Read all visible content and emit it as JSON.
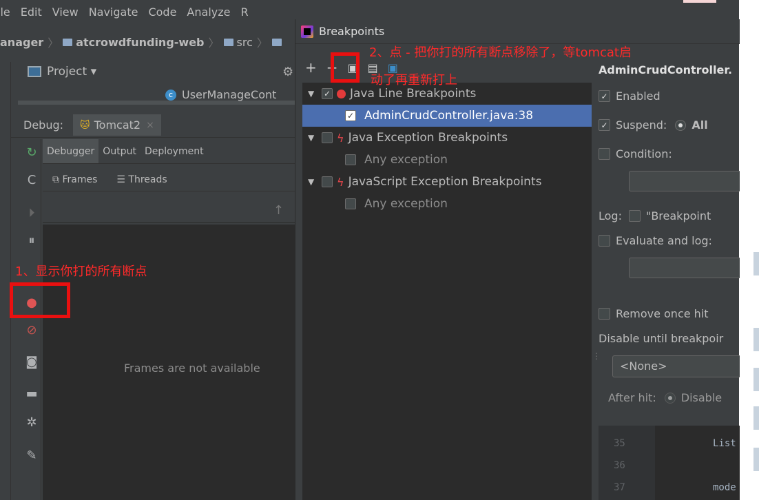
{
  "menubar": {
    "items": [
      "ile",
      "Edit",
      "View",
      "Navigate",
      "Code",
      "Analyze",
      "R"
    ]
  },
  "navbar": {
    "crumbs": [
      "anager",
      "atcrowdfunding-web",
      "src"
    ]
  },
  "project_panel": {
    "label": "Project ▾"
  },
  "editor_tab": {
    "label": "UserManageCont"
  },
  "debug": {
    "label": "Debug:",
    "config_tab": "Tomcat2",
    "subtabs": [
      "Debugger",
      "Output",
      "Deployment"
    ],
    "frames_tab": "Frames",
    "threads_tab": "Threads",
    "empty_message": "Frames are not available"
  },
  "annotations": {
    "step1": "1、显示你打的所有断点",
    "step2_line1": "2、点 - 把你打的所有断点移除了，等tomcat启",
    "step2_line2": "动了再重新打上"
  },
  "dialog": {
    "title": "Breakpoints",
    "tree": [
      {
        "label": "Java Line Breakpoints",
        "checked": true,
        "level": 0,
        "icon": "red-dot"
      },
      {
        "label": "AdminCrudController.java:38",
        "checked": true,
        "level": 1,
        "selected": true
      },
      {
        "label": "Java Exception Breakpoints",
        "checked": false,
        "level": 0,
        "icon": "bolt"
      },
      {
        "label": "Any exception",
        "checked": false,
        "level": 1
      },
      {
        "label": "JavaScript Exception Breakpoints",
        "checked": false,
        "level": 0,
        "icon": "bolt"
      },
      {
        "label": "Any exception",
        "checked": false,
        "level": 1
      }
    ],
    "props": {
      "header": "AdminCrudController.",
      "enabled": "Enabled",
      "suspend": "Suspend:",
      "suspend_all": "All",
      "condition": "Condition:",
      "log": "Log:",
      "log_breakpoint": "\"Breakpoint",
      "evaluate_log": "Evaluate and log:",
      "remove_once_hit": "Remove once hit",
      "disable_until": "Disable until breakpoir",
      "none_option": "<None>",
      "after_hit": "After hit:",
      "after_hit_value": "Disable"
    },
    "code": {
      "lines": [
        {
          "no": "35",
          "text": "List"
        },
        {
          "no": "36",
          "text": ""
        },
        {
          "no": "37",
          "text": "mode"
        }
      ]
    }
  },
  "colors": {
    "annotation_red": "#e91010",
    "selection_blue": "#4b6eaf",
    "breakpoint_red": "#e33b3b"
  }
}
